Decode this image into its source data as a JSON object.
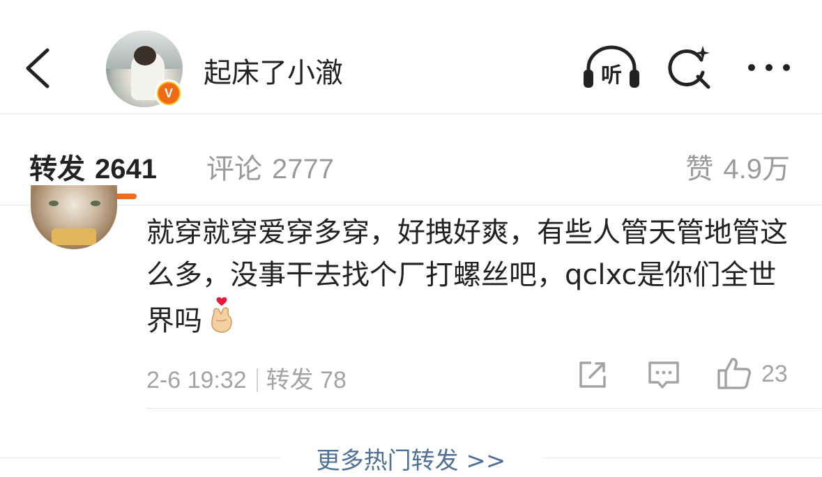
{
  "header": {
    "username": "起床了小澈",
    "verified_badge": "V",
    "listen_label": "听",
    "icons": [
      "back-icon",
      "listen-icon",
      "search-icon",
      "more-icon"
    ]
  },
  "tabs": {
    "forward": {
      "label": "转发",
      "count": "2641",
      "active": true
    },
    "comment": {
      "label": "评论",
      "count": "2777"
    },
    "like": {
      "label": "赞",
      "count": "4.9万"
    },
    "accent_color": "#f26b1d"
  },
  "comment": {
    "text": "就穿就穿爱穿多穿，好拽好爽，有些人管天管地管这么多，没事干去找个厂打螺丝吧，qclxc是你们全世界吗",
    "emoji": "finger-heart-emoji",
    "time": "2-6 19:32",
    "forward_label": "转发",
    "forward_count": "78",
    "like_count": "23"
  },
  "footer": {
    "more_label": "更多热门转发 >>",
    "link_color": "#4f6f95"
  }
}
